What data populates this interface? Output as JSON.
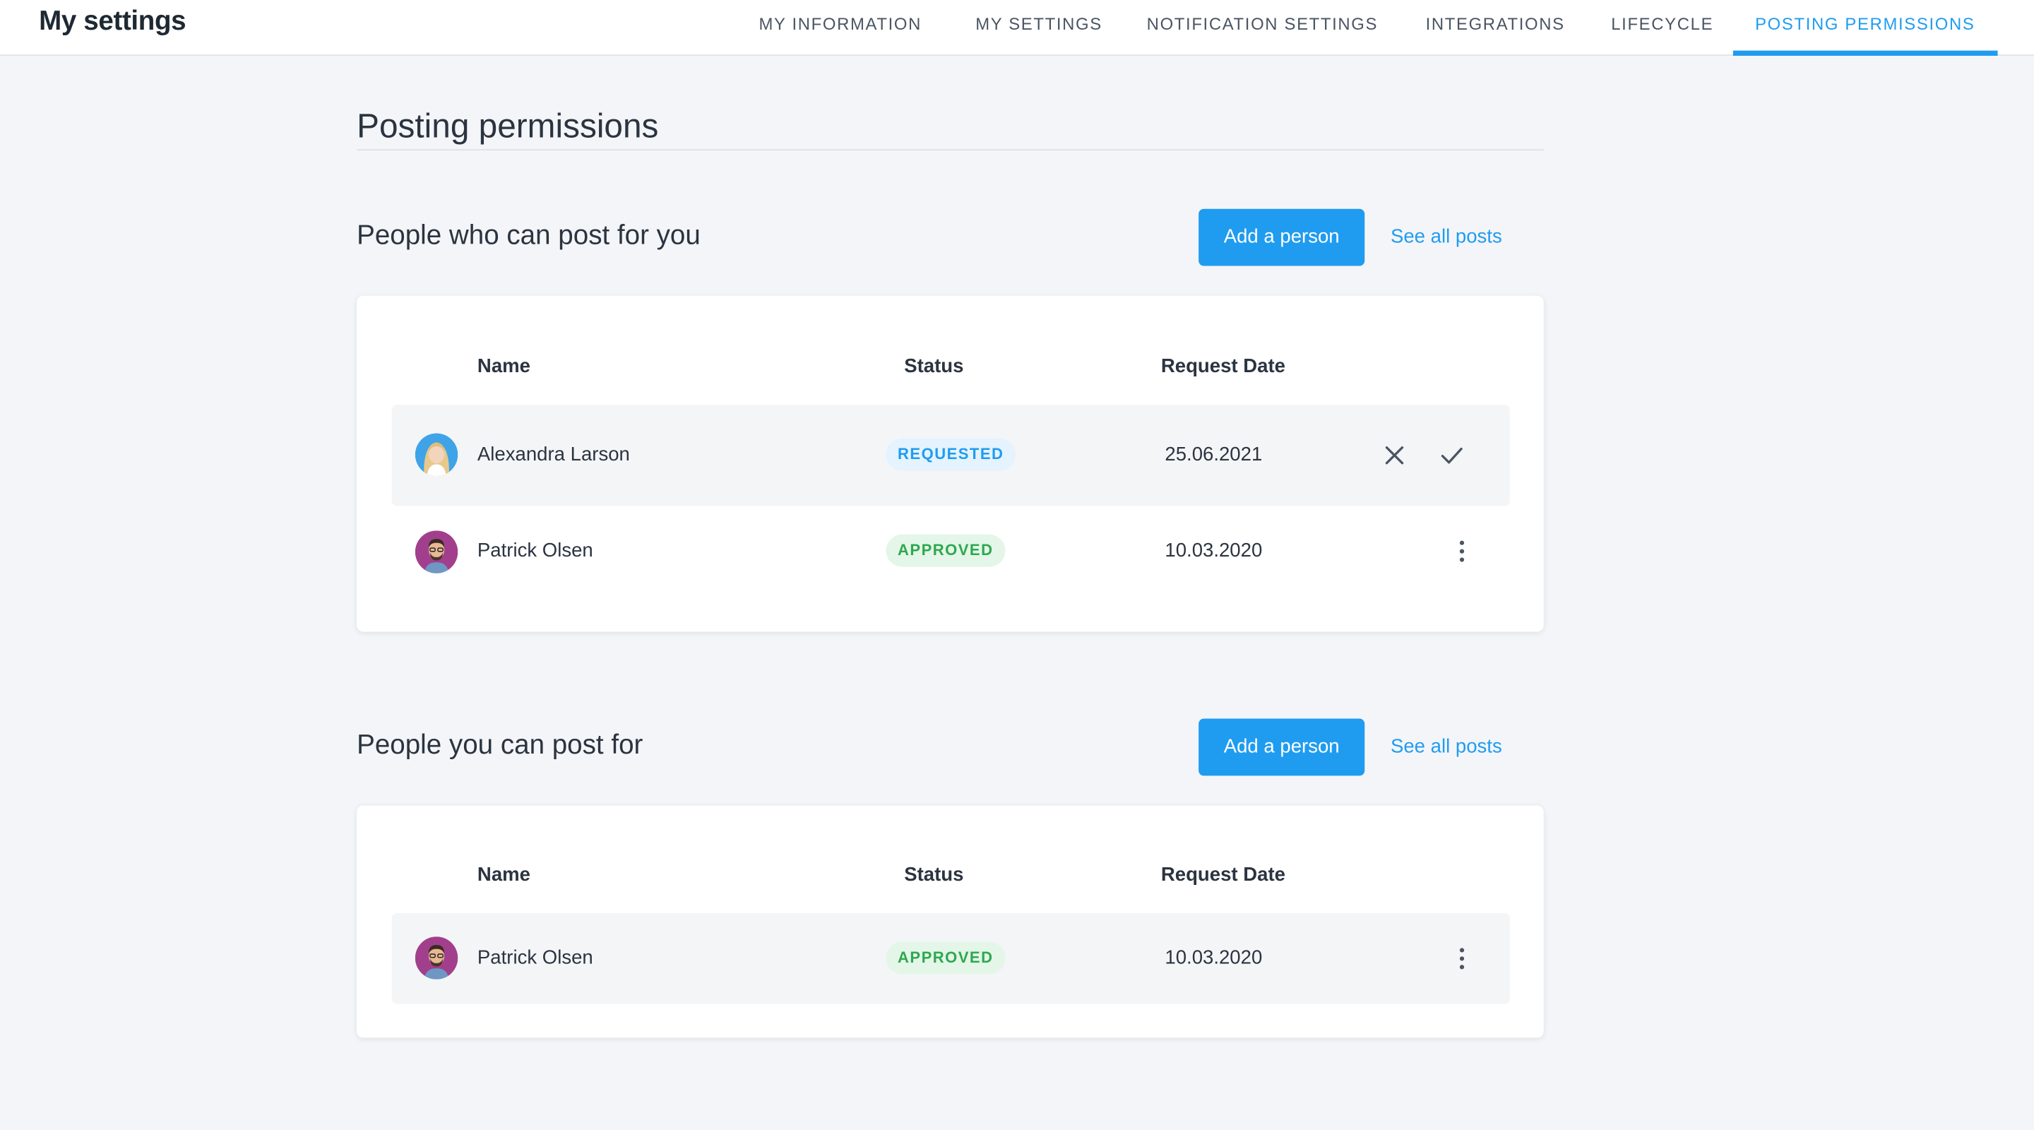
{
  "header": {
    "app_title": "My settings",
    "tabs": [
      {
        "label": "MY INFORMATION"
      },
      {
        "label": "MY SETTINGS"
      },
      {
        "label": "NOTIFICATION SETTINGS"
      },
      {
        "label": "INTEGRATIONS"
      },
      {
        "label": "LIFECYCLE"
      },
      {
        "label": "POSTING PERMISSIONS",
        "active": true
      }
    ]
  },
  "page": {
    "title": "Posting permissions"
  },
  "sections": [
    {
      "title": "People who can post for you",
      "add_button": "Add a person",
      "see_all_link": "See all posts",
      "columns": [
        "Name",
        "Status",
        "Request Date"
      ],
      "rows": [
        {
          "name": "Alexandra Larson",
          "status": "REQUESTED",
          "date": "25.06.2021",
          "actions": [
            "close-icon",
            "check-icon"
          ]
        },
        {
          "name": "Patrick Olsen",
          "status": "APPROVED",
          "date": "10.03.2020",
          "actions": [
            "more-vertical-icon"
          ]
        }
      ]
    },
    {
      "title": "People you can post for",
      "add_button": "Add a person",
      "see_all_link": "See all posts",
      "columns": [
        "Name",
        "Status",
        "Request Date"
      ],
      "rows": [
        {
          "name": "Patrick Olsen",
          "status": "APPROVED",
          "date": "10.03.2020",
          "actions": [
            "more-vertical-icon"
          ]
        }
      ]
    }
  ],
  "colors": {
    "accent": "#1f9cf0",
    "approved_text": "#2fa84f",
    "approved_bg": "#e3f6e8",
    "requested_bg": "#e4f3fd",
    "page_bg": "#f4f5f8"
  }
}
